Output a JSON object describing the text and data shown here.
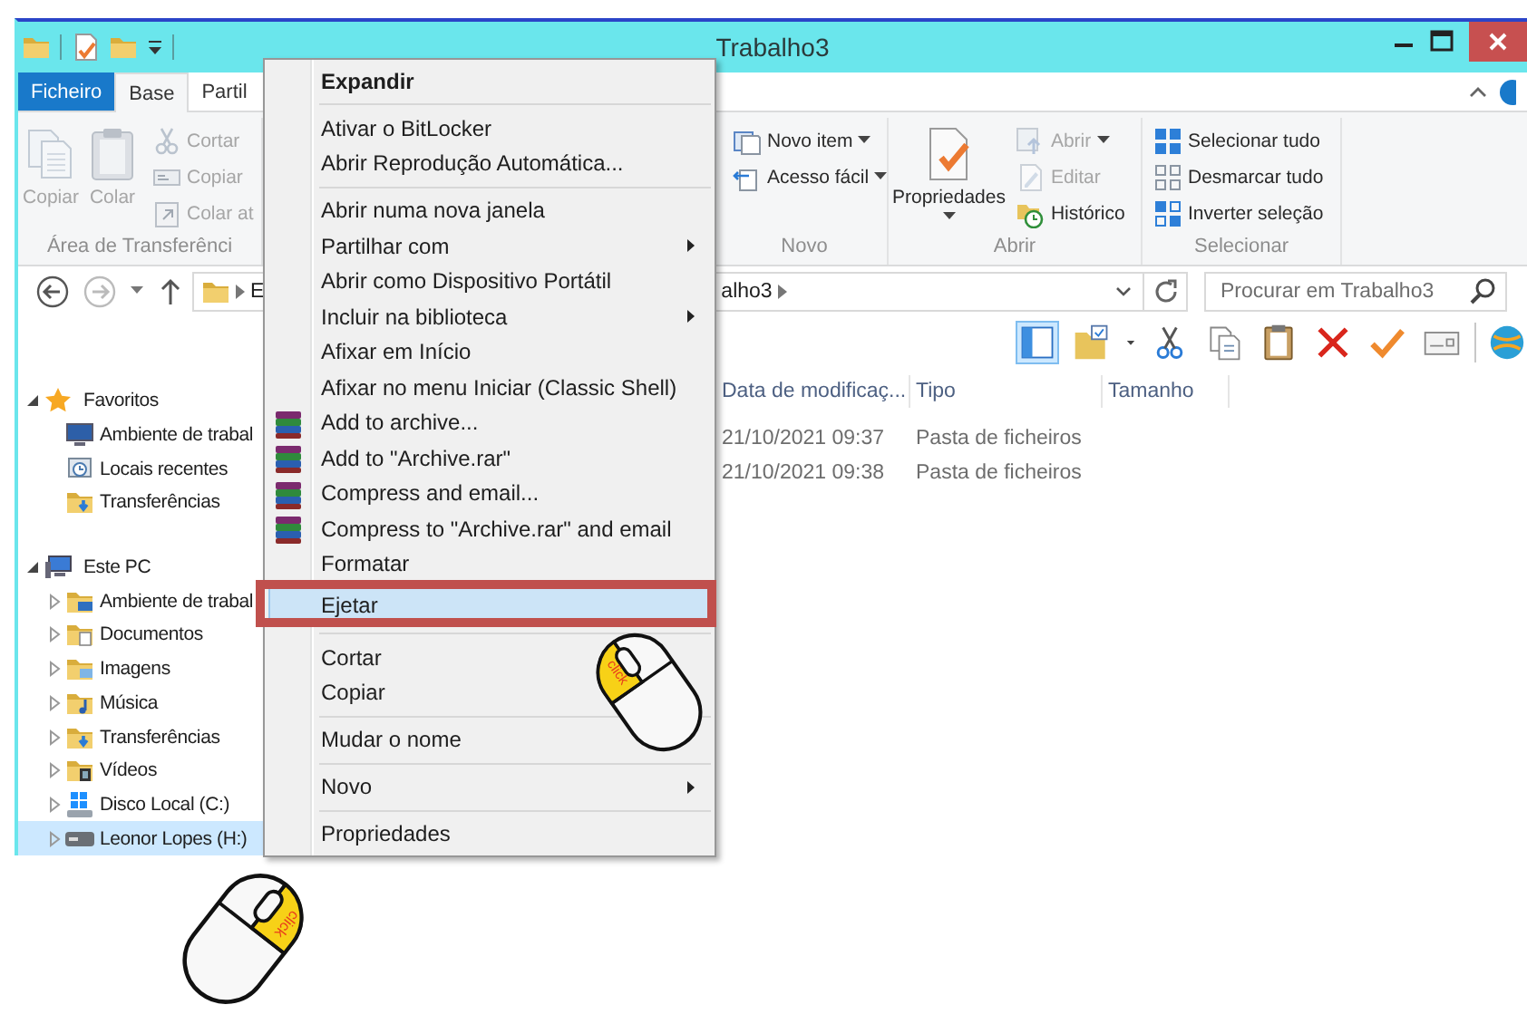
{
  "window": {
    "title": "Trabalho3"
  },
  "ribbon_tabs": [
    {
      "label": "Ficheiro",
      "kind": "file",
      "selected": false
    },
    {
      "label": "Base",
      "kind": "tab",
      "selected": true
    },
    {
      "label": "Partil",
      "kind": "tab",
      "selected": false
    }
  ],
  "ribbon_groups": [
    {
      "label": "Área de Transferênci",
      "large": [
        {
          "label": "Copiar",
          "disabled": true,
          "dropdown": false
        },
        {
          "label": "Colar",
          "disabled": true,
          "dropdown": false
        }
      ],
      "small": [
        {
          "label": "Cortar",
          "disabled": true,
          "dropdown": false
        },
        {
          "label": "Copiar",
          "disabled": true,
          "dropdown": false
        },
        {
          "label": "Colar at",
          "disabled": true,
          "dropdown": false
        }
      ]
    },
    {
      "label": "Novo",
      "small": [
        {
          "label": "Novo item",
          "disabled": false,
          "dropdown": true
        },
        {
          "label": "Acesso fácil",
          "disabled": false,
          "dropdown": true
        }
      ]
    },
    {
      "label": "Abrir",
      "large": [
        {
          "label": "Propriedades",
          "disabled": false,
          "dropdown": true
        }
      ],
      "small": [
        {
          "label": "Abrir",
          "disabled": true,
          "dropdown": true
        },
        {
          "label": "Editar",
          "disabled": true,
          "dropdown": false
        },
        {
          "label": "Histórico",
          "disabled": false,
          "dropdown": false
        }
      ]
    },
    {
      "label": "Selecionar",
      "small": [
        {
          "label": "Selecionar tudo",
          "disabled": false,
          "dropdown": false
        },
        {
          "label": "Desmarcar tudo",
          "disabled": false,
          "dropdown": false
        },
        {
          "label": "Inverter seleção",
          "disabled": false,
          "dropdown": false
        }
      ]
    }
  ],
  "address": {
    "crumbs": [
      "E",
      "alho3"
    ]
  },
  "search": {
    "placeholder": "Procurar em Trabalho3"
  },
  "toolbar": {
    "buttons": [
      {
        "selected": true
      },
      {
        "selected": false
      },
      {
        "selected": false
      },
      {
        "selected": false
      },
      {
        "selected": false
      },
      {
        "selected": false
      },
      {
        "selected": false
      },
      {
        "selected": false
      },
      {
        "selected": false
      }
    ]
  },
  "navigation": [
    {
      "label": "Favoritos",
      "expanded": true,
      "selected": false,
      "children": [
        {
          "label": "Ambiente de trabal",
          "selected": false
        },
        {
          "label": "Locais recentes",
          "selected": false
        },
        {
          "label": "Transferências",
          "selected": false
        }
      ]
    },
    {
      "label": "Este PC",
      "expanded": true,
      "selected": false,
      "children": [
        {
          "label": "Ambiente de trabal",
          "expanded": false,
          "selected": false
        },
        {
          "label": "Documentos",
          "expanded": false,
          "selected": false
        },
        {
          "label": "Imagens",
          "expanded": false,
          "selected": false
        },
        {
          "label": "Música",
          "expanded": false,
          "selected": false
        },
        {
          "label": "Transferências",
          "expanded": false,
          "selected": false
        },
        {
          "label": "Vídeos",
          "expanded": false,
          "selected": false
        },
        {
          "label": "Disco Local (C:)",
          "expanded": false,
          "selected": false
        },
        {
          "label": "Leonor Lopes (H:)",
          "expanded": false,
          "selected": true
        }
      ]
    }
  ],
  "file_list": {
    "columns": [
      "Data de modificaç...",
      "Tipo",
      "Tamanho"
    ],
    "rows": [
      {
        "date": "21/10/2021 09:37",
        "type": "Pasta de ficheiros"
      },
      {
        "date": "21/10/2021 09:38",
        "type": "Pasta de ficheiros"
      }
    ]
  },
  "context_menu": {
    "frame_selected": true,
    "items": [
      {
        "kind": "default",
        "label": "Expandir",
        "submenu": false,
        "selected": false
      },
      {
        "kind": "separator"
      },
      {
        "kind": "item",
        "label": "Ativar o BitLocker",
        "submenu": false,
        "selected": false
      },
      {
        "kind": "item",
        "label": "Abrir Reprodução Automática...",
        "submenu": false,
        "selected": false
      },
      {
        "kind": "separator"
      },
      {
        "kind": "item",
        "label": "Abrir numa nova janela",
        "submenu": false,
        "selected": false
      },
      {
        "kind": "item",
        "label": "Partilhar com",
        "submenu": true,
        "selected": false
      },
      {
        "kind": "item",
        "label": "Abrir como Dispositivo Portátil",
        "submenu": false,
        "selected": false
      },
      {
        "kind": "item",
        "label": "Incluir na biblioteca",
        "submenu": true,
        "selected": false
      },
      {
        "kind": "item",
        "label": "Afixar em Início",
        "submenu": false,
        "selected": false
      },
      {
        "kind": "item",
        "label": "Afixar no menu Iniciar (Classic Shell)",
        "submenu": false,
        "selected": false
      },
      {
        "kind": "archive",
        "label": "Add to archive...",
        "submenu": false,
        "selected": false
      },
      {
        "kind": "archive",
        "label": "Add to \"Archive.rar\"",
        "submenu": false,
        "selected": false
      },
      {
        "kind": "archive",
        "label": "Compress and email...",
        "submenu": false,
        "selected": false
      },
      {
        "kind": "archive",
        "label": "Compress to \"Archive.rar\" and email",
        "submenu": false,
        "selected": false
      },
      {
        "kind": "item",
        "label": "Formatar",
        "submenu": false,
        "selected": false
      },
      {
        "kind": "item",
        "label": "Ejetar",
        "submenu": false,
        "selected": true
      },
      {
        "kind": "separator"
      },
      {
        "kind": "item",
        "label": "Cortar",
        "submenu": false,
        "selected": false
      },
      {
        "kind": "item",
        "label": "Copiar",
        "submenu": false,
        "selected": false
      },
      {
        "kind": "separator"
      },
      {
        "kind": "item",
        "label": "Mudar o nome",
        "submenu": false,
        "selected": false
      },
      {
        "kind": "separator"
      },
      {
        "kind": "item",
        "label": "Novo",
        "submenu": true,
        "selected": false
      },
      {
        "kind": "separator"
      },
      {
        "kind": "item",
        "label": "Propriedades",
        "submenu": false,
        "selected": false
      }
    ]
  },
  "click_hints": [
    {
      "label": "click",
      "kind": "left-button"
    },
    {
      "label": "click",
      "kind": "right-button"
    }
  ]
}
